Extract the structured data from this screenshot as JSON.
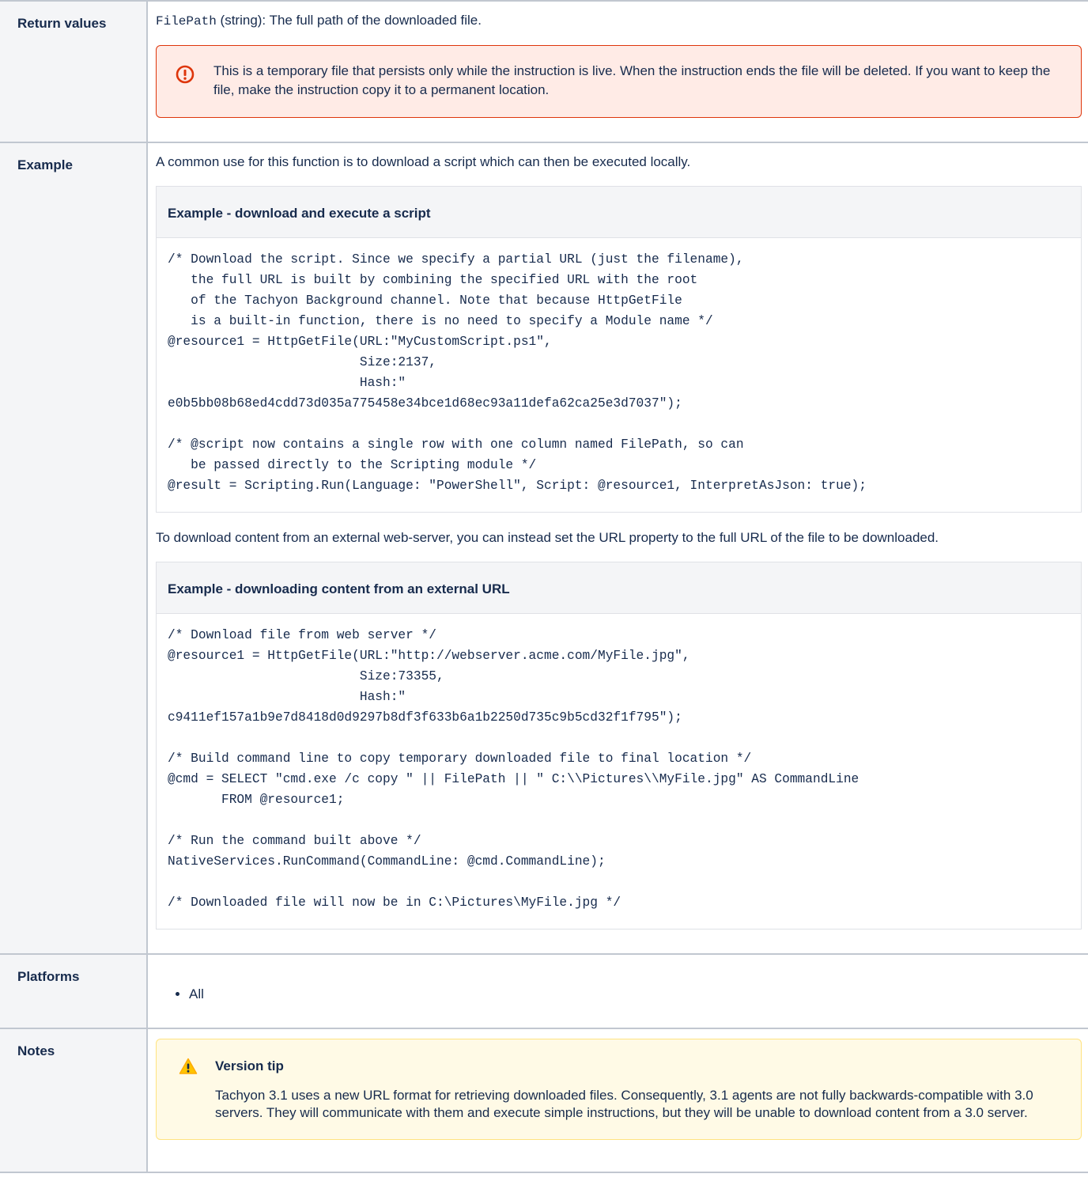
{
  "rows": {
    "return_values": {
      "label": "Return values",
      "code_name": "FilePath",
      "description": " (string): The full path of the downloaded file.",
      "error_panel_text": "This is a temporary file that persists only while the instruction is live. When the instruction ends the file will be deleted. If you want to keep the file, make the instruction copy it to a permanent location."
    },
    "example": {
      "label": "Example",
      "intro": "A common use for this function is to download a script which can then be executed locally.",
      "panel1_title": "Example - download and execute a script",
      "panel1_code": "/* Download the script. Since we specify a partial URL (just the filename),\n   the full URL is built by combining the specified URL with the root\n   of the Tachyon Background channel. Note that because HttpGetFile\n   is a built-in function, there is no need to specify a Module name */\n@resource1 = HttpGetFile(URL:\"MyCustomScript.ps1\",\n                         Size:2137,\n                         Hash:\"\ne0b5bb08b68ed4cdd73d035a775458e34bce1d68ec93a11defa62ca25e3d7037\");\n\n/* @script now contains a single row with one column named FilePath, so can\n   be passed directly to the Scripting module */\n@result = Scripting.Run(Language: \"PowerShell\", Script: @resource1, InterpretAsJson: true);",
      "middle_text": "To download content from an external web-server, you can instead set the URL property to the full URL of the file to be downloaded.",
      "panel2_title": "Example - downloading content from an external URL",
      "panel2_code": "/* Download file from web server */\n@resource1 = HttpGetFile(URL:\"http://webserver.acme.com/MyFile.jpg\",\n                         Size:73355,\n                         Hash:\"\nc9411ef157a1b9e7d8418d0d9297b8df3f633b6a1b2250d735c9b5cd32f1f795\");\n\n/* Build command line to copy temporary downloaded file to final location */\n@cmd = SELECT \"cmd.exe /c copy \" || FilePath || \" C:\\\\Pictures\\\\MyFile.jpg\" AS CommandLine\n       FROM @resource1;\n\n/* Run the command built above */\nNativeServices.RunCommand(CommandLine: @cmd.CommandLine);\n\n/* Downloaded file will now be in C:\\Pictures\\MyFile.jpg */"
    },
    "platforms": {
      "label": "Platforms",
      "items": [
        "All"
      ]
    },
    "notes": {
      "label": "Notes",
      "tip_title": "Version tip",
      "tip_text": "Tachyon 3.1 uses a new URL format for retrieving downloaded files. Consequently, 3.1 agents are not fully backwards-compatible with 3.0 servers. They will communicate with them and execute simple instructions, but they will be unable to download content from a 3.0 server."
    }
  },
  "icons": {
    "error": "error-icon",
    "warning": "warning-icon"
  },
  "colors": {
    "error_border": "#de350b",
    "error_bg": "#ffebe6",
    "warning_border": "#ffe380",
    "warning_bg": "#fffae6",
    "header_bg": "#f4f5f7",
    "table_border": "#c1c7d0"
  }
}
